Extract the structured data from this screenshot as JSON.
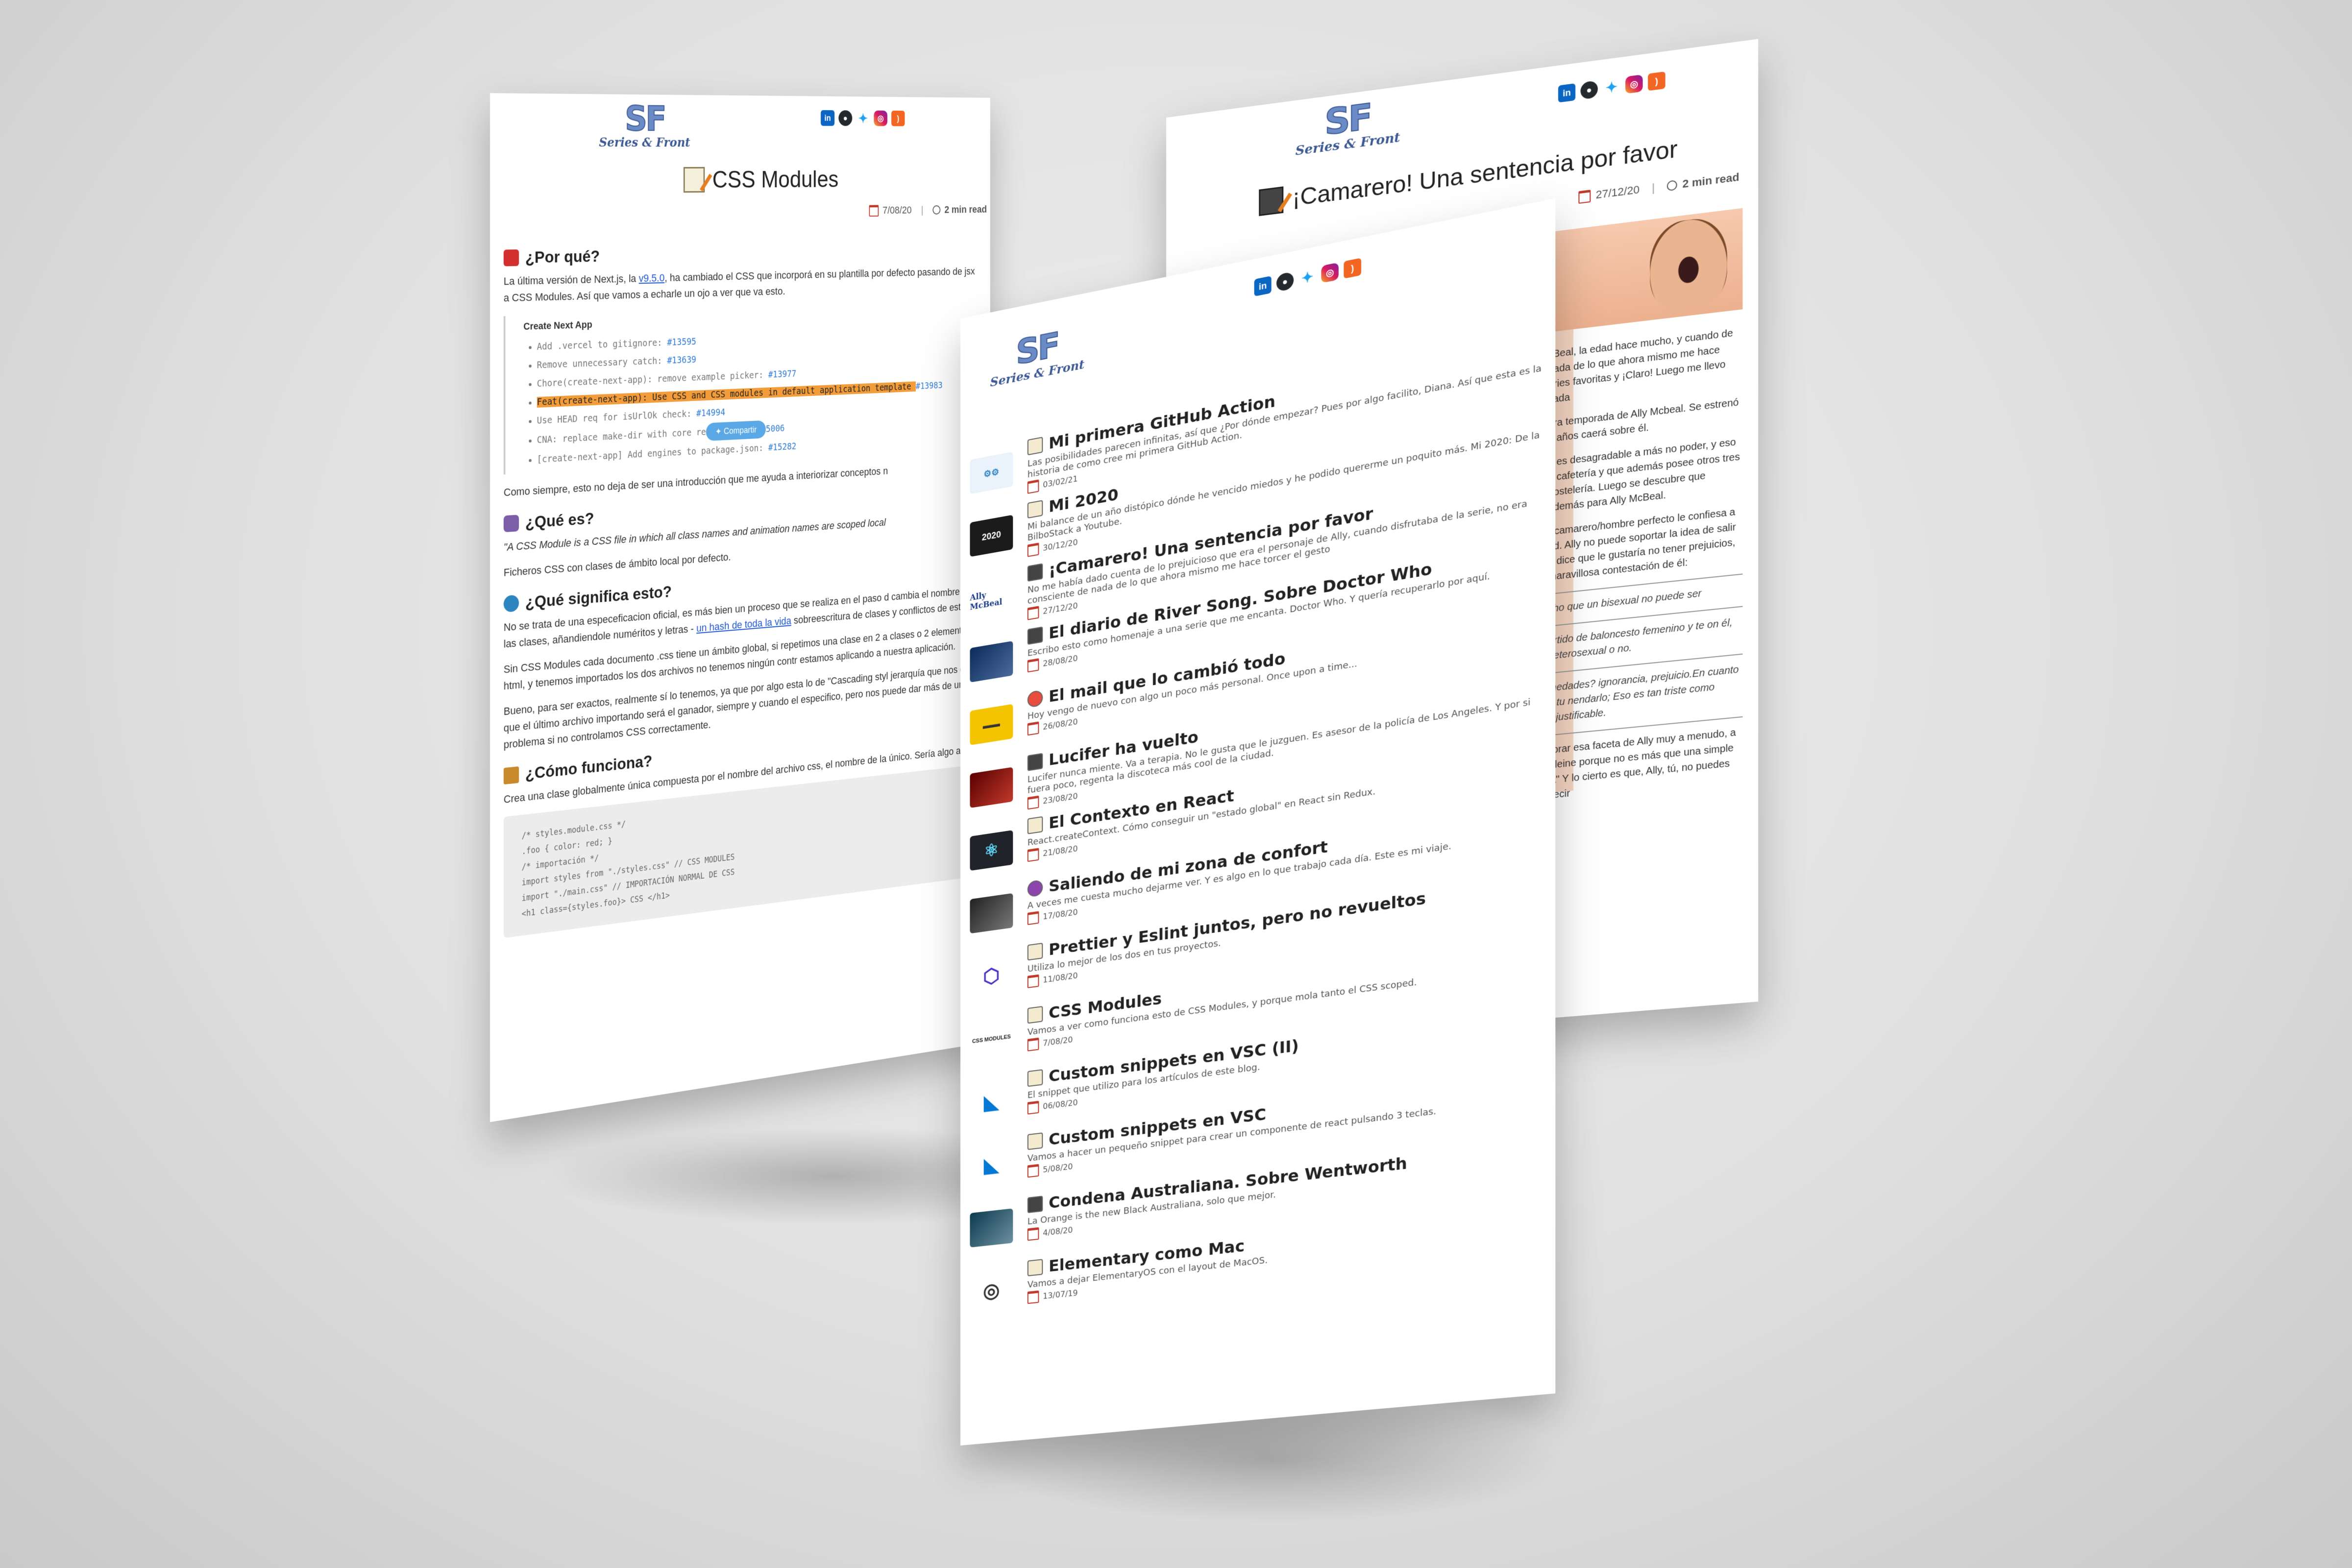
{
  "left": {
    "title": "CSS Modules",
    "date": "7/08/20",
    "read": "2 min read",
    "logo_mark": "SF",
    "logo_text": "Series & Front",
    "h_porque": "¿Por qué?",
    "p1_a": "La última versión de Next.js, la ",
    "p1_link": "v9.5.0",
    "p1_b": ", ha cambiado el CSS que incorporá en su plantilla por defecto pasando de jsx a CSS Modules. Así que vamos a echarle un ojo a ver que va esto.",
    "quote_title": "Create Next App",
    "items": [
      {
        "text": "Add .vercel to gitignore: ",
        "num": "#13595",
        "hl": false
      },
      {
        "text": "Remove unnecessary catch: ",
        "num": "#13639",
        "hl": false
      },
      {
        "text": "Chore(create-next-app): remove example picker: ",
        "num": "#13977",
        "hl": false
      },
      {
        "text": "Feat(create-next-app): Use CSS and CSS modules in default application template ",
        "num": "#13983",
        "hl": true
      },
      {
        "text": "Use HEAD req for isUrlOk check: ",
        "num": "#14994",
        "hl": false
      },
      {
        "text": "CNA: replace make-dir with core re",
        "num": "5006",
        "hl": false
      },
      {
        "text": "[create-next-app] Add engines to package.json: ",
        "num": "#15282",
        "hl": false
      }
    ],
    "share_label": "Compartir",
    "p2": "Como siempre, esto no deja de ser una introducción que me ayuda a interiorizar conceptos n",
    "h_quees": "¿Qué es?",
    "p3": "\"A CSS Module is a CSS file in which all class names and animation names are scoped local",
    "p4": "Ficheros CSS con clases de ámbito local por defecto.",
    "h_significa": "¿Qué significa esto?",
    "p5_a": "No se trata de una especeficacion oficial, es más bien un proceso que se realiza en el paso d cambia el nombre de las clases, añandiendole numéritos y letras - ",
    "p5_link": "un hash de toda la vida",
    "p5_b": " sobreescritura de clases y conflictos de estilos.",
    "p6": "Sin CSS Modules cada documento .css tiene un ámbito global, si repetimos una clase en 2 a clases o 2 elementos html, y tenemos importados los dos archivos no tenemos ningún contr estamos aplicando a nuestra aplicación.",
    "p7": "Bueno, para ser exactos, realmente sí lo tenemos, ya que por algo esta lo de \"Cascading styl jerarquía que nos dice que el último archivo importando será el ganador, siempre y cuando el especifico, pero nos puede dar más de un problema si no controlamos CSS correctamente.",
    "h_funciona": "¿Cómo funciona?",
    "p8": "Crea una clase globalmente única compuesta por el nombre del archivo css, el nombre de la único. Sería algo así.",
    "code": [
      "/* styles.module.css */",
      ".foo { color: red; }",
      "",
      "/* importación */",
      "import styles from \"./styles.css\" // CSS MODULES",
      "import \"./main.css\" // IMPORTACIÓN NORMAL DE CSS",
      "<h1 class={styles.foo}> CSS </h1>"
    ]
  },
  "right": {
    "title": "¡Camarero! Una sentencia por favor",
    "date": "27/12/20",
    "read": "2 min read",
    "logo_mark": "SF",
    "logo_text": "Series & Front",
    "paras": [
      "cBeal, la edad hace mucho, y cuando de nada de lo que ahora mismo me hace eries favoritas y ¡Claro! Luego me llevo cada",
      "era temporada de Ally Mcbeal. Se estrenó 1 años caerá sobre él.",
      "a es desagradable a más no poder, y eso a cafetería y que además posee otros tres hostelería. Luego se descubre que además para Ally McBeal.",
      "r/camarero/hombre perfecto le confiesa a ad. Ally no puede soportar la idea de salir e dice que le gustaría no tener prejuicios, maravillosa contestación de él:"
    ],
    "quote1": "cho que un bisexual no puede ser",
    "quote2": "artido de baloncesto femenino y te on él, heterosexual o no.",
    "quote3": "medades? ignorancia, prejuicio.En cuanto a tu nendarlo; Eso es tan triste como injustificable.",
    "tail": "llorar esa faceta de Ally muy a menudo, a Eleine porque no es más que una simple la\" Y lo cierto es que, Ally, tú, no puedes decir"
  },
  "front": {
    "logo_mark": "SF",
    "logo_text": "Series & Front",
    "posts": [
      {
        "title": "Mi primera GitHub Action",
        "desc": "Las posibilidades parecen infinitas, así que ¿Por dónde empezar? Pues por algo facilito, Diana. Así que esta es la historia de como cree mi primera GitHub Action.",
        "date": "03/02/21",
        "thumb": "github-actions-thumb"
      },
      {
        "title": "Mi 2020",
        "desc": "Mi balance de un año distópico dónde he vencido miedos y he podido quererme un poquito más. Mi 2020: De la BilboStack a Youtube.",
        "date": "30/12/20",
        "thumb": "2020-thumb",
        "thumb_text": "2020"
      },
      {
        "title": "¡Camarero! Una sentencia por favor",
        "desc": "No me había dado cuenta de lo prejuicioso que era el personaje de Ally, cuando disfrutaba de la serie, no era consciente de nada de lo que ahora mismo me hace torcer el gesto",
        "date": "27/12/20",
        "thumb": "ally-mcbeal-thumb",
        "thumb_text": "Ally McBeal"
      },
      {
        "title": "El diario de River Song. Sobre Doctor Who",
        "desc": "Escribo esto como homenaje a una serie que me encanta. Doctor Who. Y quería recuperarlo por aquí.",
        "date": "28/08/20",
        "thumb": "doctor-who-thumb"
      },
      {
        "title": "El mail que lo cambió todo",
        "desc": "Hoy vengo de nuevo con algo un poco más personal. Once upon a time...",
        "date": "26/08/20",
        "thumb": "bus-thumb"
      },
      {
        "title": "Lucifer ha vuelto",
        "desc": "Lucifer nunca miente. Va a terapia. No le gusta que le juzguen. Es asesor de la policía de Los Angeles. Y por si fuera poco, regenta la discoteca más cool de la ciudad.",
        "date": "23/08/20",
        "thumb": "lucifer-thumb"
      },
      {
        "title": "El Contexto en React",
        "desc": "React.createContext. Cómo conseguir un \"estado global\" en React sin Redux.",
        "date": "21/08/20",
        "thumb": "react-thumb"
      },
      {
        "title": "Saliendo de mi zona de confort",
        "desc": "A veces me cuesta mucho dejarme ver. Y es algo en lo que trabajo cada día. Este es mi viaje.",
        "date": "17/08/20",
        "thumb": "comfort-zone-thumb"
      },
      {
        "title": "Prettier y Eslint juntos, pero no revueltos",
        "desc": "Utiliza lo mejor de los dos en tus proyectos.",
        "date": "11/08/20",
        "thumb": "eslint-thumb"
      },
      {
        "title": "CSS Modules",
        "desc": "Vamos a ver como funciona esto de CSS Modules, y porque mola tanto el CSS scoped.",
        "date": "7/08/20",
        "thumb": "css-modules-thumb",
        "thumb_text": "CSS MODULES"
      },
      {
        "title": "Custom snippets en VSC (II)",
        "desc": "El snippet que utilizo para los artículos de este blog.",
        "date": "06/08/20",
        "thumb": "vscode-thumb"
      },
      {
        "title": "Custom snippets en VSC",
        "desc": "Vamos a hacer un pequeño snippet para crear un componente de react pulsando 3 teclas.",
        "date": "5/08/20",
        "thumb": "vscode-thumb-2"
      },
      {
        "title": "Condena Australiana. Sobre Wentworth",
        "desc": "La Orange is the new Black Australiana, solo que mejor.",
        "date": "4/08/20",
        "thumb": "wentworth-thumb"
      },
      {
        "title": "Elementary como Mac",
        "desc": "Vamos a dejar ElementaryOS con el layout de MacOS.",
        "date": "13/07/19",
        "thumb": "elementary-thumb"
      }
    ]
  }
}
